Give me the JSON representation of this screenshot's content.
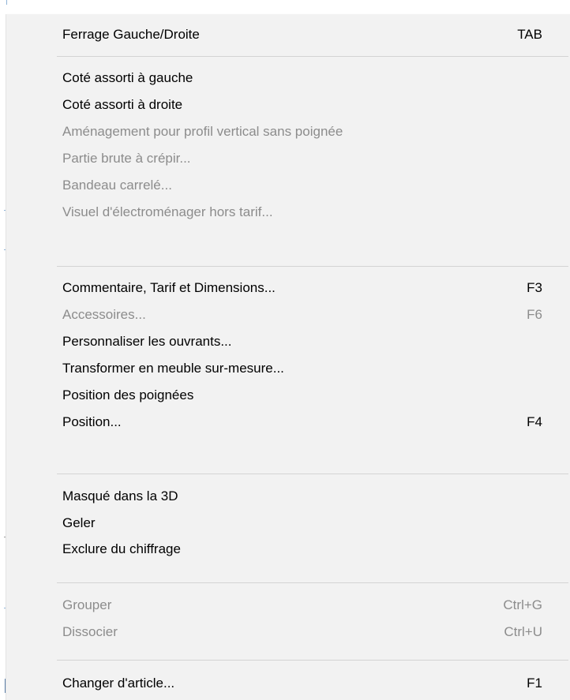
{
  "menu": {
    "groups": [
      [
        {
          "label": "Ferrage Gauche/Droite",
          "shortcut": "TAB",
          "enabled": true
        }
      ],
      [
        {
          "label": "Coté assorti à gauche",
          "shortcut": "",
          "enabled": true
        },
        {
          "label": "Coté assorti à droite",
          "shortcut": "",
          "enabled": true
        },
        {
          "label": "Aménagement pour profil vertical sans poignée",
          "shortcut": "",
          "enabled": false
        },
        {
          "label": "Partie brute à crépir...",
          "shortcut": "",
          "enabled": false
        },
        {
          "label": "Bandeau carrelé...",
          "shortcut": "",
          "enabled": false
        },
        {
          "label": "Visuel d'électroménager hors tarif...",
          "shortcut": "",
          "enabled": false
        }
      ],
      [
        {
          "label": "Commentaire, Tarif et Dimensions...",
          "shortcut": "F3",
          "enabled": true
        },
        {
          "label": "Accessoires...",
          "shortcut": "F6",
          "enabled": false
        },
        {
          "label": "Personnaliser les ouvrants...",
          "shortcut": "",
          "enabled": true
        },
        {
          "label": "Transformer en meuble sur-mesure...",
          "shortcut": "",
          "enabled": true
        },
        {
          "label": "Position des poignées",
          "shortcut": "",
          "enabled": true
        },
        {
          "label": "Position...",
          "shortcut": "F4",
          "enabled": true
        }
      ],
      [
        {
          "label": "Masqué dans la 3D",
          "shortcut": "",
          "enabled": true
        },
        {
          "label": "Geler",
          "shortcut": "",
          "enabled": true
        },
        {
          "label": "Exclure du chiffrage",
          "shortcut": "",
          "enabled": true
        }
      ],
      [
        {
          "label": "Grouper",
          "shortcut": "Ctrl+G",
          "enabled": false
        },
        {
          "label": "Dissocier",
          "shortcut": "Ctrl+U",
          "enabled": false
        }
      ],
      [
        {
          "label": "Changer d'article...",
          "shortcut": "F1",
          "enabled": true
        }
      ]
    ]
  },
  "colors": {
    "menu_background": "#f2f2f2",
    "text_enabled": "#000000",
    "text_disabled": "#8c8c8c",
    "separator": "#d4d4d4"
  }
}
